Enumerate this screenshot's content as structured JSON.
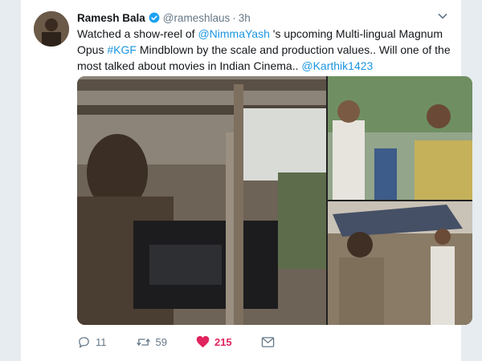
{
  "tweet": {
    "author_name": "Ramesh Bala",
    "handle": "@rameshlaus",
    "separator": "·",
    "time": "3h",
    "text_parts": [
      {
        "text": "Watched a show-reel of ",
        "link": false
      },
      {
        "text": "@NimmaYash",
        "link": true
      },
      {
        "text": " 's upcoming Multi-lingual Magnum Opus ",
        "link": false
      },
      {
        "text": "#KGF",
        "link": true
      },
      {
        "text": " Mindblown by the scale and production values.. Will one of the most talked about movies in Indian Cinema.. ",
        "link": false
      },
      {
        "text": "@Karthik1423",
        "link": true
      }
    ]
  },
  "actions": {
    "reply_count": "11",
    "retweet_count": "59",
    "like_count": "215"
  },
  "icons": {
    "verified": "verified-badge-icon",
    "caret": "chevron-down-icon",
    "reply": "reply-icon",
    "retweet": "retweet-icon",
    "like": "heart-icon",
    "message": "envelope-icon"
  },
  "colors": {
    "link": "#1b95e0",
    "like": "#e0245e",
    "muted": "#657786",
    "text": "#14171a"
  }
}
